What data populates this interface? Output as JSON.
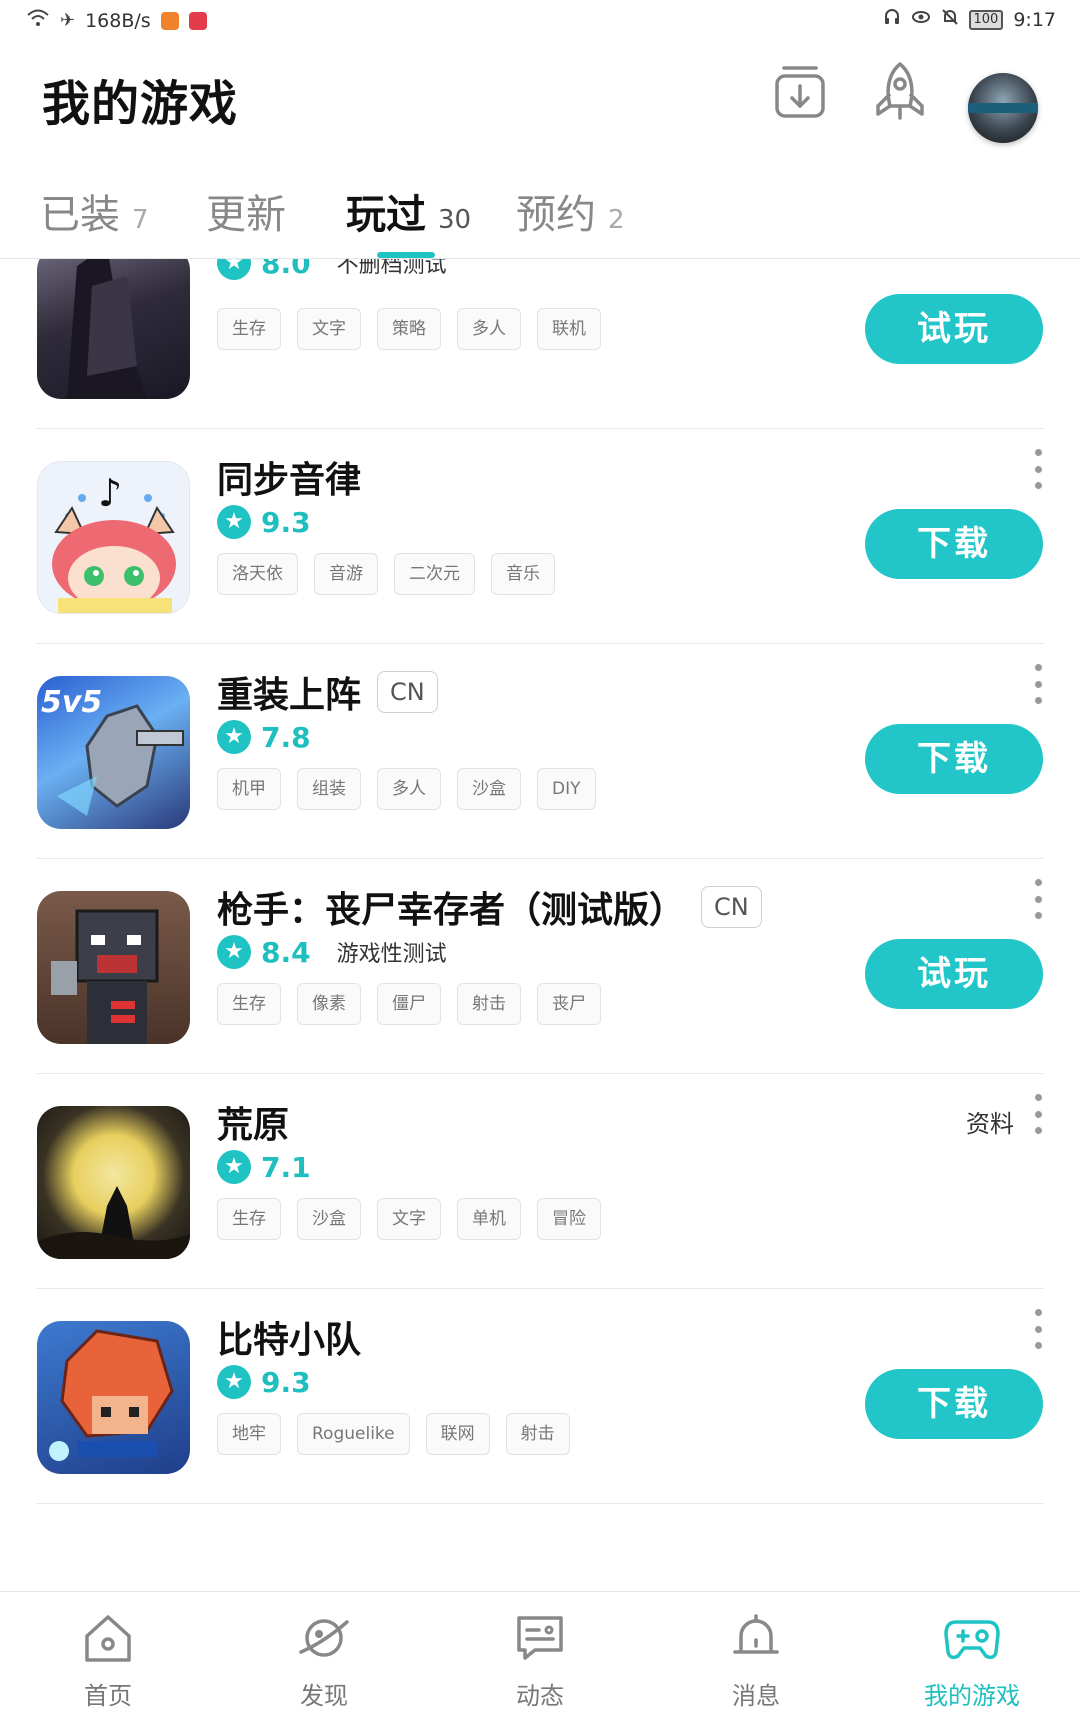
{
  "status_bar": {
    "net_speed": "168B/s",
    "battery": "100",
    "time": "9:17"
  },
  "header": {
    "title": "我的游戏"
  },
  "tabs": [
    {
      "label": "已装",
      "count": "7"
    },
    {
      "label": "更新",
      "count": ""
    },
    {
      "label": "玩过",
      "count": "30"
    },
    {
      "label": "预约",
      "count": "2"
    }
  ],
  "games": [
    {
      "name": "",
      "badge": "",
      "score": "8.0",
      "note": "不删档测试",
      "tags": [
        "生存",
        "文字",
        "策略",
        "多人",
        "联机"
      ],
      "action": "试玩"
    },
    {
      "name": "同步音律",
      "badge": "",
      "score": "9.3",
      "note": "",
      "tags": [
        "洛天依",
        "音游",
        "二次元",
        "音乐"
      ],
      "action": "下载"
    },
    {
      "name": "重装上阵",
      "badge": "CN",
      "score": "7.8",
      "note": "",
      "tags": [
        "机甲",
        "组装",
        "多人",
        "沙盒",
        "DIY"
      ],
      "action": "下载"
    },
    {
      "name": "枪手：丧尸幸存者（测试版）",
      "badge": "CN",
      "score": "8.4",
      "note": "游戏性测试",
      "tags": [
        "生存",
        "像素",
        "僵尸",
        "射击",
        "丧尸"
      ],
      "action": "试玩"
    },
    {
      "name": "荒原",
      "badge": "",
      "score": "7.1",
      "note": "",
      "tags": [
        "生存",
        "沙盒",
        "文字",
        "单机",
        "冒险"
      ],
      "action": "",
      "link": "资料"
    },
    {
      "name": "比特小队",
      "badge": "",
      "score": "9.3",
      "note": "",
      "tags": [
        "地牢",
        "Roguelike",
        "联网",
        "射击"
      ],
      "action": "下载"
    }
  ],
  "bottom_nav": [
    {
      "label": "首页",
      "icon": "home-icon"
    },
    {
      "label": "发现",
      "icon": "planet-icon"
    },
    {
      "label": "动态",
      "icon": "chat-icon"
    },
    {
      "label": "消息",
      "icon": "bell-icon"
    },
    {
      "label": "我的游戏",
      "icon": "gamepad-icon"
    }
  ],
  "colors": {
    "accent": "#23c6c8",
    "text": "#111111",
    "muted": "#888888"
  }
}
